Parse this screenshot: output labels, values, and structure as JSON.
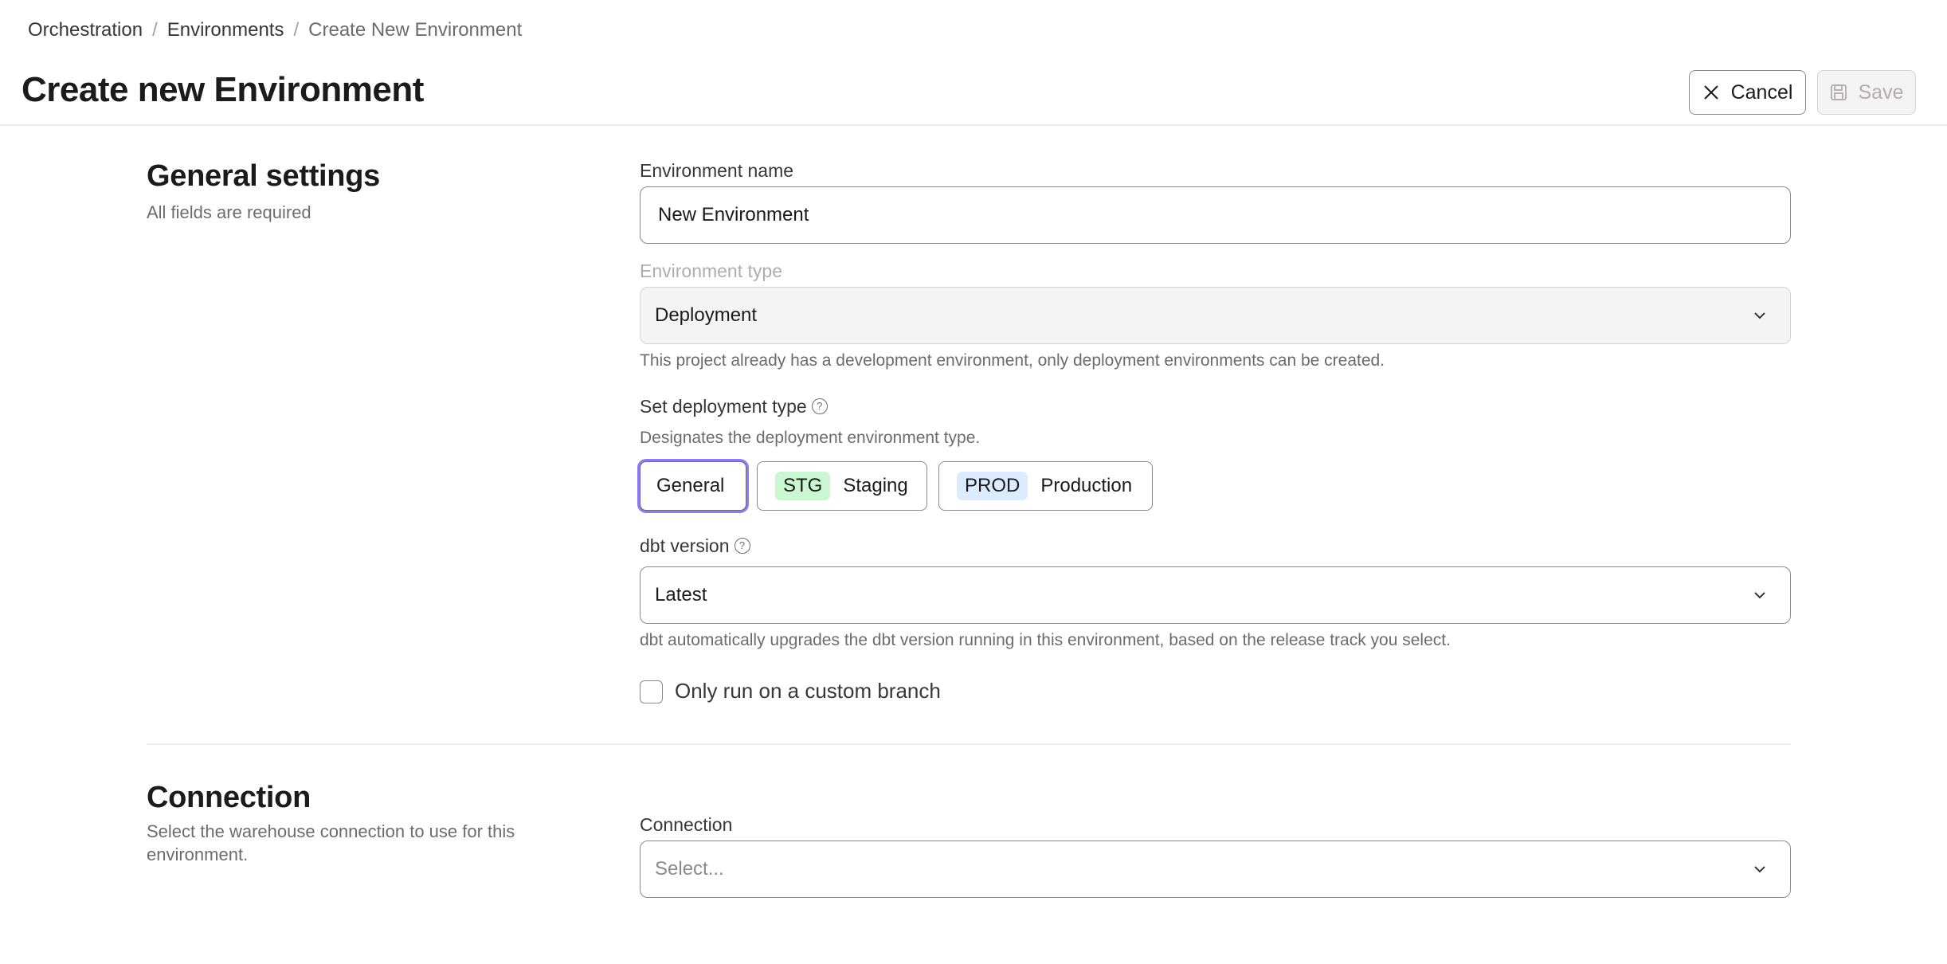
{
  "breadcrumb": {
    "items": [
      "Orchestration",
      "Environments",
      "Create New Environment"
    ],
    "separator": "/"
  },
  "header": {
    "title": "Create new Environment",
    "cancel_label": "Cancel",
    "save_label": "Save"
  },
  "general": {
    "title": "General settings",
    "subtitle": "All fields are required",
    "env_name": {
      "label": "Environment name",
      "value": "New Environment"
    },
    "env_type": {
      "label": "Environment type",
      "value": "Deployment",
      "help": "This project already has a development environment, only deployment environments can be created."
    },
    "deployment_type": {
      "label": "Set deployment type",
      "help": "Designates the deployment environment type.",
      "selected": "General",
      "options": [
        {
          "label": "General",
          "tag": null
        },
        {
          "label": "Staging",
          "tag": "STG"
        },
        {
          "label": "Production",
          "tag": "PROD"
        }
      ]
    },
    "dbt_version": {
      "label": "dbt version",
      "value": "Latest",
      "help": "dbt automatically upgrades the dbt version running in this environment, based on the release track you select."
    },
    "custom_branch": {
      "label": "Only run on a custom branch",
      "checked": false
    }
  },
  "connection": {
    "title": "Connection",
    "subtitle_line1": "Select the warehouse connection to use for this",
    "subtitle_line2": "environment.",
    "field_label": "Connection",
    "placeholder": "Select..."
  },
  "colors": {
    "focus_ring": "#8b7cf6",
    "stg_tag_bg": "#c9f7d2",
    "prod_tag_bg": "#dcebff"
  }
}
